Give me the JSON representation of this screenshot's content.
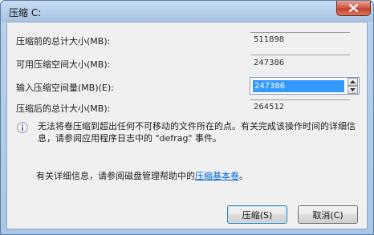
{
  "window": {
    "title": "压缩 C:"
  },
  "rows": {
    "total_before_label": "压缩前的总计大小(MB):",
    "total_before_value": "511898",
    "available_label": "可用压缩空间大小(MB):",
    "available_value": "247386",
    "input_label": "输入压缩空间量(MB)(E):",
    "input_value": "247386",
    "total_after_label": "压缩后的总计大小(MB):",
    "total_after_value": "264512"
  },
  "info": {
    "text": "无法将卷压缩到超出任何不可移动的文件所在的点。有关完成该操作时间的详细信息，请参阅应用程序日志中的 \"defrag\" 事件。"
  },
  "detail": {
    "prefix": "有关详细信息，请参阅磁盘管理帮助中的",
    "link": "压缩基本卷",
    "suffix": "。"
  },
  "buttons": {
    "shrink": "压缩(S)",
    "cancel": "取消(C)"
  },
  "icons": {
    "close": "close-icon",
    "info": "info-icon",
    "spin_up": "chevron-up-icon",
    "spin_down": "chevron-down-icon"
  }
}
